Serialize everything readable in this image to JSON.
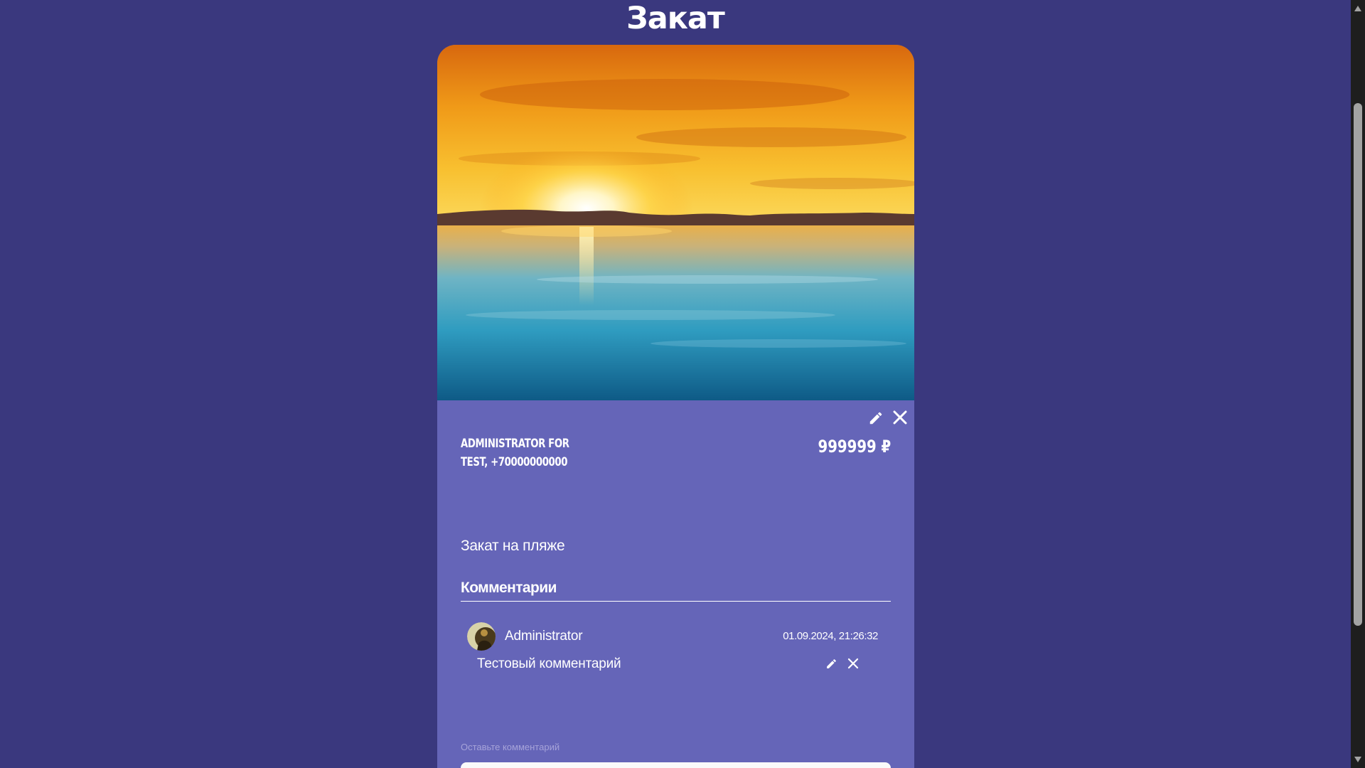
{
  "post": {
    "title": "Закат",
    "author": "Administrator for Test, +70000000000",
    "price": "999999 ₽",
    "description": "Закат на пляже"
  },
  "comments": {
    "heading": "Комментарии",
    "items": [
      {
        "author": "Administrator",
        "date": "01.09.2024, 21:26:32",
        "text": "Тестовый комментарий"
      }
    ],
    "leave_label": "Оставьте комментарий",
    "input_value": ""
  },
  "icons": {
    "edit": "pencil-icon",
    "delete": "close-icon"
  },
  "colors": {
    "background": "#3a387e",
    "card": "#6565b8",
    "input": "#fafafa",
    "scrollbar": "#1e1e1e"
  }
}
